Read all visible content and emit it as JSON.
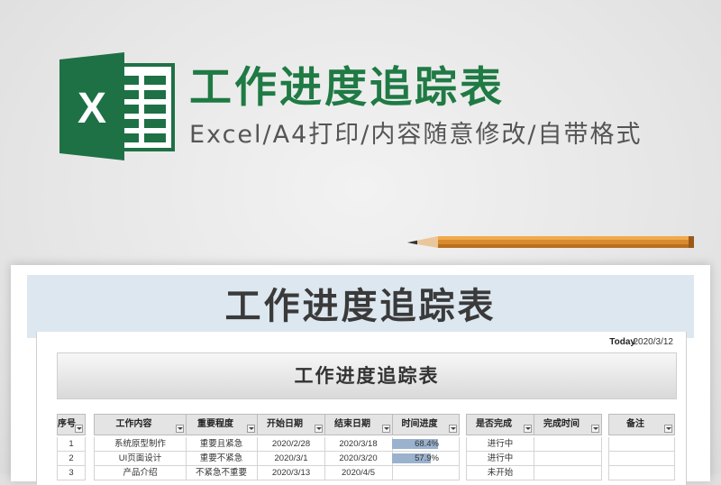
{
  "banner": {
    "title": "工作进度追踪表",
    "subtitle": "Excel/A4打印/内容随意修改/自带格式",
    "logo_letter": "X",
    "logo_color": "#1e7145",
    "title_color": "#1f7a44"
  },
  "sheet": {
    "header_title": "工作进度追踪表",
    "today_label": "Today",
    "today_value": "2020/3/12",
    "inner_title": "工作进度追踪表",
    "columns": {
      "seq": "序号",
      "content": "工作内容",
      "priority": "重要程度",
      "start": "开始日期",
      "end": "结束日期",
      "progress": "时间进度",
      "done": "是否完成",
      "done_time": "完成时间",
      "note": "备注"
    },
    "rows": [
      {
        "seq": "1",
        "content": "系统原型制作",
        "priority": "重要且紧急",
        "start": "2020/2/28",
        "end": "2020/3/18",
        "progress_text": "68.4%",
        "progress": 0.684,
        "done": "进行中",
        "done_time": "",
        "note": ""
      },
      {
        "seq": "2",
        "content": "UI页面设计",
        "priority": "重要不紧急",
        "start": "2020/3/1",
        "end": "2020/3/20",
        "progress_text": "57.9%",
        "progress": 0.579,
        "done": "进行中",
        "done_time": "",
        "note": ""
      },
      {
        "seq": "3",
        "content": "产品介绍",
        "priority": "不紧急不重要",
        "start": "2020/3/13",
        "end": "2020/4/5",
        "progress_text": "",
        "progress": 0,
        "done": "未开始",
        "done_time": "",
        "note": ""
      }
    ],
    "progress_color": "#9ab2cd"
  }
}
